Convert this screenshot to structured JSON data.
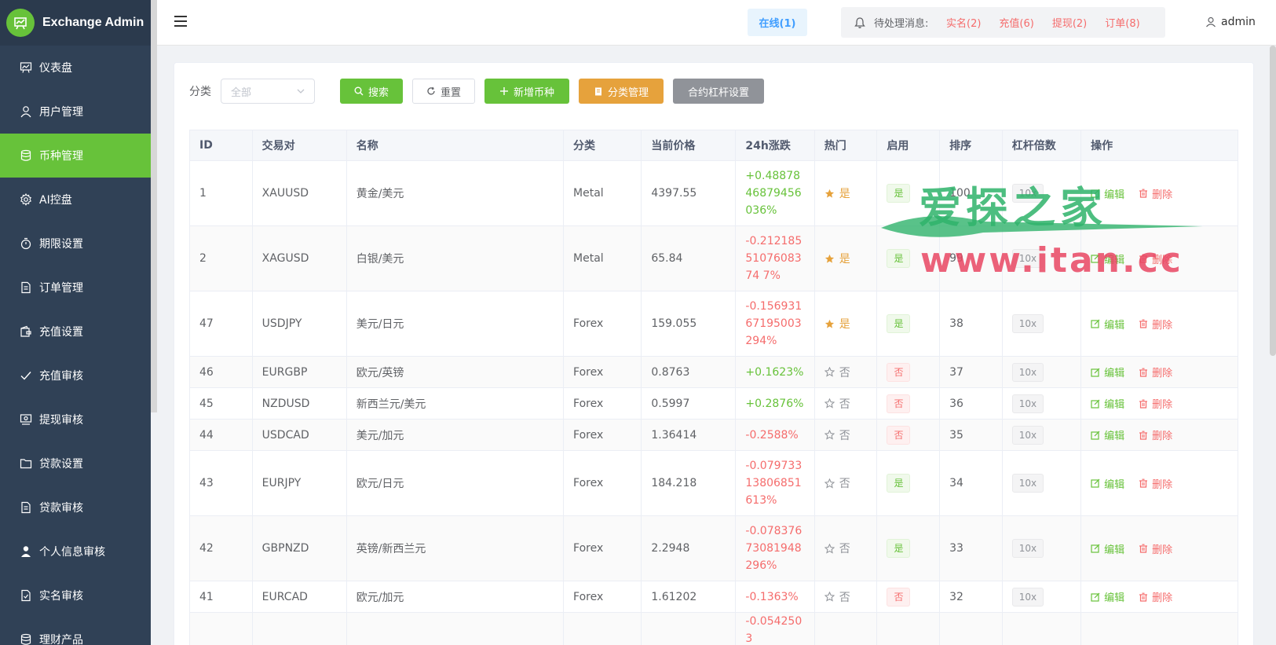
{
  "brand": {
    "title": "Exchange Admin"
  },
  "sidebar": {
    "items": [
      {
        "label": "仪表盘",
        "icon": "dashboard-icon",
        "active": false
      },
      {
        "label": "用户管理",
        "icon": "user-icon",
        "active": false
      },
      {
        "label": "币种管理",
        "icon": "database-icon",
        "active": true
      },
      {
        "label": "AI控盘",
        "icon": "gear-icon",
        "active": false
      },
      {
        "label": "期限设置",
        "icon": "timer-icon",
        "active": false
      },
      {
        "label": "订单管理",
        "icon": "document-icon",
        "active": false
      },
      {
        "label": "充值设置",
        "icon": "wallet-icon",
        "active": false
      },
      {
        "label": "充值审核",
        "icon": "check-icon",
        "active": false
      },
      {
        "label": "提现审核",
        "icon": "withdraw-icon",
        "active": false
      },
      {
        "label": "贷款设置",
        "icon": "folder-icon",
        "active": false
      },
      {
        "label": "贷款审核",
        "icon": "document-icon",
        "active": false
      },
      {
        "label": "个人信息审核",
        "icon": "person-icon",
        "active": false
      },
      {
        "label": "实名审核",
        "icon": "id-check-icon",
        "active": false
      },
      {
        "label": "理财产品",
        "icon": "database-icon",
        "active": false
      }
    ]
  },
  "header": {
    "online": "在线(1)",
    "pending_label": "待处理消息:",
    "pending_links": [
      "实名(2)",
      "充值(6)",
      "提现(2)",
      "订单(8)"
    ],
    "user": "admin"
  },
  "filter": {
    "label": "分类",
    "select_value": "全部",
    "search": "搜索",
    "reset": "重置",
    "add": "新增币种",
    "category": "分类管理",
    "leverage": "合约杠杆设置"
  },
  "table": {
    "columns": [
      "ID",
      "交易对",
      "名称",
      "分类",
      "当前价格",
      "24h涨跌",
      "热门",
      "启用",
      "排序",
      "杠杆倍数",
      "操作"
    ],
    "edit_label": "编辑",
    "delete_label": "删除",
    "rows": [
      {
        "id": "1",
        "pair": "XAUUSD",
        "name": "黄金/美元",
        "category": "Metal",
        "price": "4397.55",
        "change": "+0.4887846879456036%",
        "hot": "是",
        "enabled": "是",
        "sort": "100",
        "leverage": "10x"
      },
      {
        "id": "2",
        "pair": "XAGUSD",
        "name": "白银/美元",
        "category": "Metal",
        "price": "65.84",
        "change": "-0.2121855107608374 7%",
        "hot": "是",
        "enabled": "是",
        "sort": "99",
        "leverage": "10x"
      },
      {
        "id": "47",
        "pair": "USDJPY",
        "name": "美元/日元",
        "category": "Forex",
        "price": "159.055",
        "change": "-0.15693167195003294%",
        "hot": "是",
        "enabled": "是",
        "sort": "38",
        "leverage": "10x"
      },
      {
        "id": "46",
        "pair": "EURGBP",
        "name": "欧元/英镑",
        "category": "Forex",
        "price": "0.8763",
        "change": "+0.1623%",
        "hot": "否",
        "enabled": "否",
        "sort": "37",
        "leverage": "10x"
      },
      {
        "id": "45",
        "pair": "NZDUSD",
        "name": "新西兰元/美元",
        "category": "Forex",
        "price": "0.5997",
        "change": "+0.2876%",
        "hot": "否",
        "enabled": "否",
        "sort": "36",
        "leverage": "10x"
      },
      {
        "id": "44",
        "pair": "USDCAD",
        "name": "美元/加元",
        "category": "Forex",
        "price": "1.36414",
        "change": "-0.2588%",
        "hot": "否",
        "enabled": "否",
        "sort": "35",
        "leverage": "10x"
      },
      {
        "id": "43",
        "pair": "EURJPY",
        "name": "欧元/日元",
        "category": "Forex",
        "price": "184.218",
        "change": "-0.07973313806851613%",
        "hot": "否",
        "enabled": "是",
        "sort": "34",
        "leverage": "10x"
      },
      {
        "id": "42",
        "pair": "GBPNZD",
        "name": "英镑/新西兰元",
        "category": "Forex",
        "price": "2.2948",
        "change": "-0.07837673081948296%",
        "hot": "否",
        "enabled": "是",
        "sort": "33",
        "leverage": "10x"
      },
      {
        "id": "41",
        "pair": "EURCAD",
        "name": "欧元/加元",
        "category": "Forex",
        "price": "1.61202",
        "change": "-0.1363%",
        "hot": "否",
        "enabled": "否",
        "sort": "32",
        "leverage": "10x"
      },
      {
        "id": "",
        "pair": "",
        "name": "",
        "category": "",
        "price": "",
        "change": "-0.0542503",
        "hot": "",
        "enabled": "",
        "sort": "",
        "leverage": ""
      }
    ]
  },
  "watermark": {
    "top": "爱探之家",
    "url": "www.itan.cc"
  },
  "colors": {
    "sidebar": "#304156",
    "accent": "#67c23a",
    "danger": "#f56c6c",
    "warning": "#e6a23c",
    "info": "#909399"
  }
}
